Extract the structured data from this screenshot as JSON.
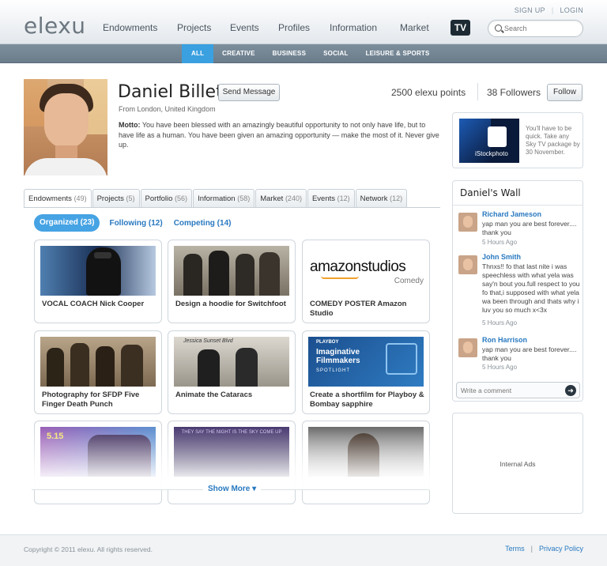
{
  "toplinks": {
    "signup": "SIGN UP",
    "sep": "|",
    "login": "LOGIN"
  },
  "header": {
    "logo": "elexu",
    "nav": [
      "Endowments",
      "Projects",
      "Events",
      "Profiles",
      "Information",
      "Market"
    ],
    "tv": "TV",
    "search_placeholder": "Search"
  },
  "subnav": [
    "ALL",
    "CREATIVE",
    "BUSINESS",
    "SOCIAL",
    "LEISURE & SPORTS"
  ],
  "profile": {
    "name": "Daniel Billett",
    "send_message": "Send Message",
    "from": "From London, United Kingdom",
    "motto_label": "Motto:",
    "motto_text": " You have been blessed with an amazingly beautiful opportunity to not only have life, but to have life as a human. You have been given an amazing opportunity — make the most of it. Never give up.",
    "points": "2500 elexu points",
    "followers": "38 Followers",
    "follow": "Follow"
  },
  "ad": {
    "image_label": "iStockphoto",
    "text": "You'll have to be quick. Take any Sky TV package by 30 November."
  },
  "tabs": [
    {
      "label": "Endowments",
      "count": "(49)"
    },
    {
      "label": "Projects",
      "count": "(5)"
    },
    {
      "label": "Portfolio",
      "count": "(56)"
    },
    {
      "label": "Information",
      "count": "(58)"
    },
    {
      "label": "Market",
      "count": "(240)"
    },
    {
      "label": "Events",
      "count": "(12)"
    },
    {
      "label": "Network",
      "count": "(12)"
    }
  ],
  "filters": [
    "Organized (23)",
    "Following (12)",
    "Competing (14)"
  ],
  "cards": [
    {
      "title": "VOCAL COACH Nick Cooper"
    },
    {
      "title": "Design a hoodie for Switchfoot"
    },
    {
      "title": "COMEDY POSTER Amazon Studio",
      "logo_main": "amazonstudios",
      "logo_sub": "Comedy"
    },
    {
      "title": "Photography for SFDP Five Finger Death Punch"
    },
    {
      "title": "Animate the Cataracs",
      "thumb_text": "Jessica Sunset Blvd"
    },
    {
      "title": "Create a shortfilm for Playboy & Bombay sapphire",
      "thumb_line1": "PLAYBOY",
      "thumb_line2": "Imaginative Filmmakers",
      "thumb_line3": "SPOTLIGHT"
    },
    {
      "title": "",
      "thumb_text": "5.15"
    },
    {
      "title": "",
      "thumb_text": "THEY SAY THE NIGHT IS THE SKY COME UP"
    },
    {
      "title": ""
    }
  ],
  "show_more": "Show More ▾",
  "wall": {
    "title": "Daniel's Wall",
    "posts": [
      {
        "name": "Richard Jameson",
        "text": "yap man you are best forever.... thank you",
        "time": "5 Hours Ago"
      },
      {
        "name": "John Smith",
        "text": "Thnxs!! fo that last nite i was speechless with what yela was say'n bout you.full respect to you fo that,i supposed with what yela wa been through and thats why i luv you so much x<3x",
        "time": "5 Hours Ago"
      },
      {
        "name": "Ron Harrison",
        "text": "yap man you are best forever.... thank you",
        "time": "5 Hours Ago"
      }
    ],
    "comment_placeholder": "Write a comment",
    "comment_go": "➜"
  },
  "internal_ads": "Internal Ads",
  "footer": {
    "copyright": "Copyright © 2011 elexu. All rights reserved.",
    "terms": "Terms",
    "sep": "|",
    "privacy": "Privacy Policy"
  }
}
